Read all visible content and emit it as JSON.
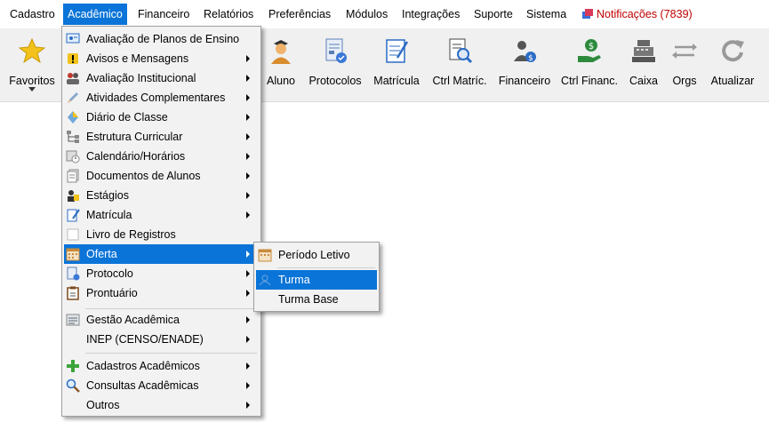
{
  "menubar": {
    "items": [
      "Cadastro",
      "Acadêmico",
      "Financeiro",
      "Relatórios",
      "Preferências",
      "Módulos",
      "Integrações",
      "Suporte",
      "Sistema"
    ],
    "notifications": "Notificações (7839)"
  },
  "toolbar": {
    "buttons": [
      "Favoritos",
      "Aluno",
      "Protocolos",
      "Matrícula",
      "Ctrl Matríc.",
      "Financeiro",
      "Ctrl Financ.",
      "Caixa",
      "Orgs",
      "Atualizar"
    ]
  },
  "menu": {
    "items": [
      "Avaliação de Planos de Ensino",
      "Avisos e Mensagens",
      "Avaliação Institucional",
      "Atividades Complementares",
      "Diário de Classe",
      "Estrutura Curricular",
      "Calendário/Horários",
      "Documentos de Alunos",
      "Estágios",
      "Matrícula",
      "Livro de Registros",
      "Oferta",
      "Protocolo",
      "Prontuário",
      "Gestão Acadêmica",
      "INEP (CENSO/ENADE)",
      "Cadastros Acadêmicos",
      "Consultas Acadêmicas",
      "Outros"
    ]
  },
  "submenu": {
    "items": [
      "Período Letivo",
      "Turma",
      "Turma Base"
    ]
  },
  "colors": {
    "highlight": "#0a74d8",
    "notification": "#c00000"
  }
}
